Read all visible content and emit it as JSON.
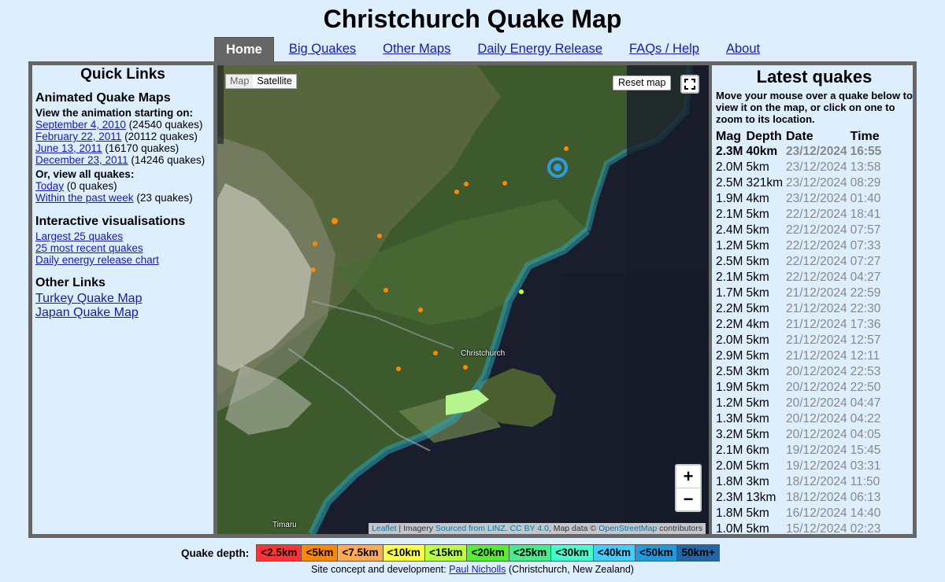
{
  "title": "Christchurch Quake Map",
  "nav": [
    "Home",
    "Big Quakes",
    "Other Maps",
    "Daily Energy Release",
    "FAQs / Help",
    "About"
  ],
  "left": {
    "heading": "Quick Links",
    "animated_heading": "Animated Quake Maps",
    "animation_intro": "View the animation starting on:",
    "animations": [
      {
        "link": "September 4, 2010",
        "count": "(24540 quakes)"
      },
      {
        "link": "February 22, 2011",
        "count": "(20112 quakes)"
      },
      {
        "link": "June 13, 2011",
        "count": "(16170 quakes)"
      },
      {
        "link": "December 23, 2011",
        "count": "(14246 quakes)"
      }
    ],
    "view_all_intro": "Or, view all quakes:",
    "view_all": [
      {
        "link": "Today",
        "count": "(0 quakes)"
      },
      {
        "link": "Within the past week",
        "count": "(23 quakes)"
      }
    ],
    "vis_heading": "Interactive visualisations",
    "vis_links": [
      "Largest 25 quakes",
      "25 most recent quakes",
      "Daily energy release chart"
    ],
    "other_heading": "Other Links",
    "other_links": [
      "Turkey Quake Map",
      "Japan Quake Map"
    ]
  },
  "map": {
    "type_toggle": {
      "map": "Map",
      "satellite": "Satellite",
      "selected": "Satellite"
    },
    "reset_label": "Reset map",
    "zoom_in": "+",
    "zoom_out": "−",
    "labels": {
      "christchurch": "Christchurch",
      "timaru": "Timaru"
    },
    "attribution": {
      "leaflet": "Leaflet",
      "imagery_prefix": "| Imagery",
      "imagery_link": "Sourced from LINZ. CC BY 4.0",
      "data_prefix": ", Map data ©",
      "osm_link": "OpenStreetMap",
      "suffix": "contributors"
    }
  },
  "latest": {
    "heading": "Latest quakes",
    "intro": "Move your mouse over a quake below to view it on the map, or click on one to zoom to its location.",
    "columns": [
      "Mag",
      "Depth",
      "Date",
      "Time"
    ],
    "rows": [
      [
        "2.3M",
        "40km",
        "23/12/2024",
        "16:55"
      ],
      [
        "2.0M",
        "5km",
        "23/12/2024",
        "13:58"
      ],
      [
        "2.5M",
        "321km",
        "23/12/2024",
        "08:29"
      ],
      [
        "1.9M",
        "4km",
        "23/12/2024",
        "01:40"
      ],
      [
        "2.1M",
        "5km",
        "22/12/2024",
        "18:41"
      ],
      [
        "2.4M",
        "5km",
        "22/12/2024",
        "07:57"
      ],
      [
        "1.2M",
        "5km",
        "22/12/2024",
        "07:33"
      ],
      [
        "2.5M",
        "5km",
        "22/12/2024",
        "07:27"
      ],
      [
        "2.1M",
        "5km",
        "22/12/2024",
        "04:27"
      ],
      [
        "1.7M",
        "5km",
        "21/12/2024",
        "22:59"
      ],
      [
        "2.2M",
        "5km",
        "21/12/2024",
        "22:30"
      ],
      [
        "2.2M",
        "4km",
        "21/12/2024",
        "17:36"
      ],
      [
        "2.0M",
        "5km",
        "21/12/2024",
        "12:57"
      ],
      [
        "2.9M",
        "5km",
        "21/12/2024",
        "12:11"
      ],
      [
        "2.5M",
        "3km",
        "20/12/2024",
        "22:53"
      ],
      [
        "1.9M",
        "5km",
        "20/12/2024",
        "22:50"
      ],
      [
        "1.2M",
        "5km",
        "20/12/2024",
        "04:47"
      ],
      [
        "1.3M",
        "5km",
        "20/12/2024",
        "04:22"
      ],
      [
        "3.2M",
        "5km",
        "20/12/2024",
        "04:05"
      ],
      [
        "2.1M",
        "6km",
        "19/12/2024",
        "15:45"
      ],
      [
        "2.0M",
        "5km",
        "19/12/2024",
        "03:31"
      ],
      [
        "1.8M",
        "3km",
        "18/12/2024",
        "11:50"
      ],
      [
        "2.3M",
        "13km",
        "18/12/2024",
        "06:13"
      ],
      [
        "1.8M",
        "5km",
        "16/12/2024",
        "14:40"
      ],
      [
        "1.0M",
        "5km",
        "15/12/2024",
        "02:23"
      ]
    ]
  },
  "legend": {
    "label": "Quake depth:",
    "items": [
      {
        "text": "<2.5km",
        "color": "#ff3333"
      },
      {
        "text": "<5km",
        "color": "#ff8800"
      },
      {
        "text": "<7.5km",
        "color": "#ffaa55"
      },
      {
        "text": "<10km",
        "color": "#ffff44"
      },
      {
        "text": "<15km",
        "color": "#bbff44"
      },
      {
        "text": "<20km",
        "color": "#55ee33"
      },
      {
        "text": "<25km",
        "color": "#44ee88"
      },
      {
        "text": "<30km",
        "color": "#44ffcc"
      },
      {
        "text": "<40km",
        "color": "#44ccff"
      },
      {
        "text": "<50km",
        "color": "#2299dd"
      },
      {
        "text": "50km+",
        "color": "#2266aa"
      }
    ]
  },
  "footer": {
    "prefix": "Site concept and development:",
    "link": "Paul Nicholls",
    "suffix": "(Christchurch, New Zealand)"
  }
}
